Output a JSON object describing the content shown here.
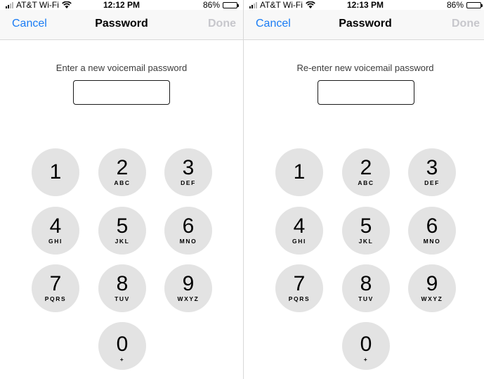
{
  "screens": [
    {
      "status": {
        "carrier": "AT&T Wi-Fi",
        "time": "12:12 PM",
        "battery": "86%"
      },
      "nav": {
        "cancel": "Cancel",
        "title": "Password",
        "done": "Done"
      },
      "prompt": "Enter a new voicemail password",
      "password_value": ""
    },
    {
      "status": {
        "carrier": "AT&T Wi-Fi",
        "time": "12:13 PM",
        "battery": "86%"
      },
      "nav": {
        "cancel": "Cancel",
        "title": "Password",
        "done": "Done"
      },
      "prompt": "Re-enter new voicemail password",
      "password_value": ""
    }
  ],
  "keypad": [
    {
      "digit": "1",
      "letters": ""
    },
    {
      "digit": "2",
      "letters": "ABC"
    },
    {
      "digit": "3",
      "letters": "DEF"
    },
    {
      "digit": "4",
      "letters": "GHI"
    },
    {
      "digit": "5",
      "letters": "JKL"
    },
    {
      "digit": "6",
      "letters": "MNO"
    },
    {
      "digit": "7",
      "letters": "PQRS"
    },
    {
      "digit": "8",
      "letters": "TUV"
    },
    {
      "digit": "9",
      "letters": "WXYZ"
    },
    {
      "digit": "0",
      "letters": "+"
    }
  ],
  "colors": {
    "accent": "#1a7cf4",
    "disabled": "#c7c7cc",
    "key_bg": "#e3e3e3"
  },
  "battery_level": 0.86
}
